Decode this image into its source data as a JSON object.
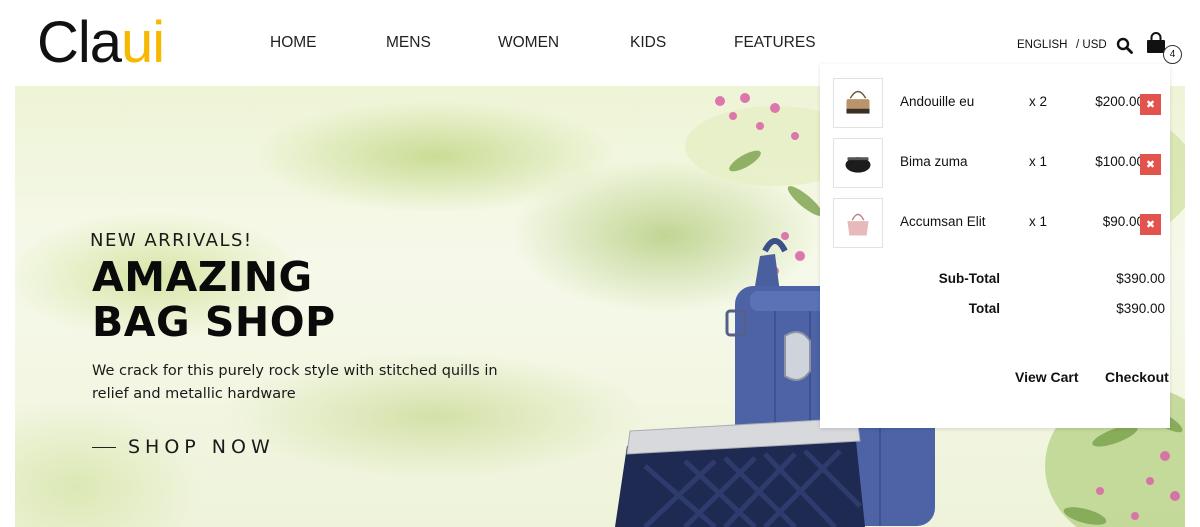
{
  "logo": {
    "part1": "Cla",
    "part2": "ui",
    "accent_color": "#f6b800"
  },
  "nav": {
    "items": [
      {
        "label": "HOME"
      },
      {
        "label": "MENS"
      },
      {
        "label": "WOMEN"
      },
      {
        "label": "KIDS"
      },
      {
        "label": "FEATURES"
      }
    ]
  },
  "header_utils": {
    "language": "ENGLISH",
    "currency": "/ USD",
    "search_icon": "search-icon",
    "cart_icon": "shopping-bag-icon",
    "cart_count": "4"
  },
  "hero": {
    "kicker": "NEW ARRIVALS!",
    "title_line1": "AMAZING",
    "title_line2": "BAG SHOP",
    "description": "We crack for this purely rock style with stitched quills in relief and metallic hardware",
    "cta": "SHOP NOW"
  },
  "cart": {
    "items": [
      {
        "name": "Andouille eu",
        "qty": "x 2",
        "price": "$200.00",
        "remove": "✖",
        "thumb": "handbag-tan"
      },
      {
        "name": "Bima zuma",
        "qty": "x 1",
        "price": "$100.00",
        "remove": "✖",
        "thumb": "clutch-black"
      },
      {
        "name": "Accumsan Elit",
        "qty": "x 1",
        "price": "$90.00",
        "remove": "✖",
        "thumb": "handbag-pink"
      }
    ],
    "subtotal_label": "Sub-Total",
    "subtotal_value": "$390.00",
    "total_label": "Total",
    "total_value": "$390.00",
    "view_cart": "View Cart",
    "checkout": "Checkout",
    "remove_color": "#e2534d"
  }
}
